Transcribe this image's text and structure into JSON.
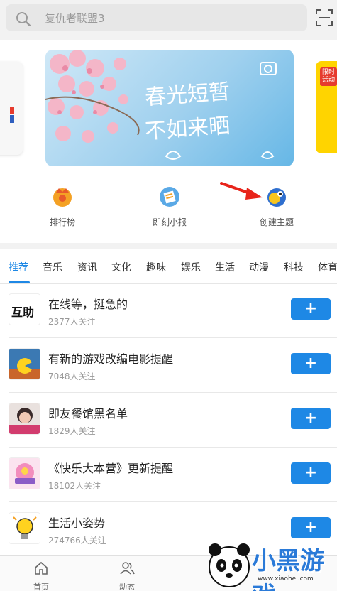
{
  "search": {
    "placeholder": "复仇者联盟3"
  },
  "banner": {
    "line1": "春光短暂",
    "line2": "不如来晒",
    "side_tag": "限时活动"
  },
  "entries": [
    {
      "label": "排行榜",
      "icon": "rank-icon",
      "color": "#f4a124"
    },
    {
      "label": "即刻小报",
      "icon": "newspaper-icon",
      "color": "#5aa9e6"
    },
    {
      "label": "创建主题",
      "icon": "create-topic-icon",
      "color": "#f7c51e"
    }
  ],
  "tabs": [
    "推荐",
    "音乐",
    "资讯",
    "文化",
    "趣味",
    "娱乐",
    "生活",
    "动漫",
    "科技",
    "体育"
  ],
  "active_tab": "推荐",
  "topics": [
    {
      "title": "在线等，挺急的",
      "followers": "2377人关注",
      "thumb_text": "互助",
      "thumb_bg": "#ffffff"
    },
    {
      "title": "有新的游戏改编电影提醒",
      "followers": "7048人关注",
      "thumb_text": "",
      "thumb_bg": "#2a5c8a"
    },
    {
      "title": "即友餐馆黑名单",
      "followers": "1829人关注",
      "thumb_text": "",
      "thumb_bg": "#c96a8a"
    },
    {
      "title": "《快乐大本营》更新提醒",
      "followers": "18102人关注",
      "thumb_text": "",
      "thumb_bg": "#f0c0d8"
    },
    {
      "title": "生活小姿势",
      "followers": "274766人关注",
      "thumb_text": "",
      "thumb_bg": "#fff4c0"
    }
  ],
  "follow_label": "+",
  "nav": [
    {
      "label": "首页",
      "icon": "home-icon"
    },
    {
      "label": "动态",
      "icon": "people-icon"
    }
  ],
  "watermark": {
    "text": "小黑游戏",
    "url": "www.xiaohei.com"
  },
  "colors": {
    "accent": "#1e88e5"
  }
}
